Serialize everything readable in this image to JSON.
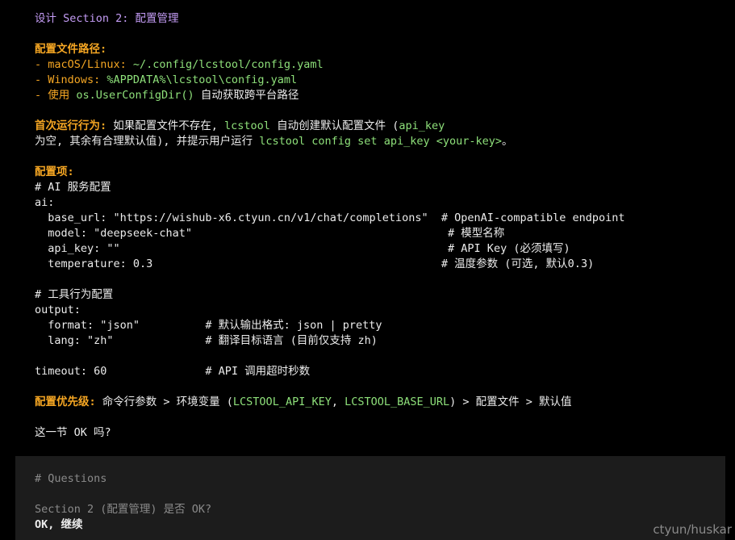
{
  "section_title": "设计 Section 2: 配置管理",
  "paths": {
    "heading": "配置文件路径:",
    "mac_prefix": "- macOS/Linux: ",
    "mac_path": "~/.config/lcstool/config.yaml",
    "win_prefix": "- Windows: ",
    "win_path": "%APPDATA%\\lcstool\\config.yaml",
    "use_prefix": "- 使用 ",
    "use_fn": "os.UserConfigDir()",
    "use_suffix": " 自动获取跨平台路径"
  },
  "first_run": {
    "heading": "首次运行行为:",
    "text1": " 如果配置文件不存在, ",
    "cmd1": "lcstool",
    "text2": " 自动创建默认配置文件 (",
    "key1": "api_key",
    "text3": "为空, 其余有合理默认值), 并提示用户运行 ",
    "cmd2": "lcstool config set api_key <your-key>",
    "text4": "。"
  },
  "config_items": {
    "heading": "配置项:",
    "lines": [
      "# AI 服务配置",
      "ai:",
      "  base_url: \"https://wishub-x6.ctyun.cn/v1/chat/completions\"  # OpenAI-compatible endpoint",
      "  model: \"deepseek-chat\"                                       # 模型名称",
      "  api_key: \"\"                                                  # API Key (必须填写)",
      "  temperature: 0.3                                            # 温度参数 (可选, 默认0.3)",
      "",
      "# 工具行为配置",
      "output:",
      "  format: \"json\"          # 默认输出格式: json | pretty",
      "  lang: \"zh\"              # 翻译目标语言 (目前仅支持 zh)",
      "",
      "timeout: 60               # API 调用超时秒数"
    ]
  },
  "priority": {
    "heading": "配置优先级:",
    "text1": " 命令行参数 > 环境变量 (",
    "env1": "LCSTOOL_API_KEY",
    "sep": ", ",
    "env2": "LCSTOOL_BASE_URL",
    "text2": ") > 配置文件 > 默认值"
  },
  "ok_question": "这一节 OK 吗?",
  "question_block": {
    "heading": "# Questions",
    "question": "Section 2 (配置管理) 是否 OK?",
    "answer": "OK, 继续"
  },
  "watermark": "ctyun/huskar",
  "colors": {
    "background": "#000000",
    "purple": "#c49cf5",
    "orange": "#f5a623",
    "green": "#8ee07a",
    "grey": "#8a8a8a",
    "block_bg": "#1c1c1c"
  }
}
